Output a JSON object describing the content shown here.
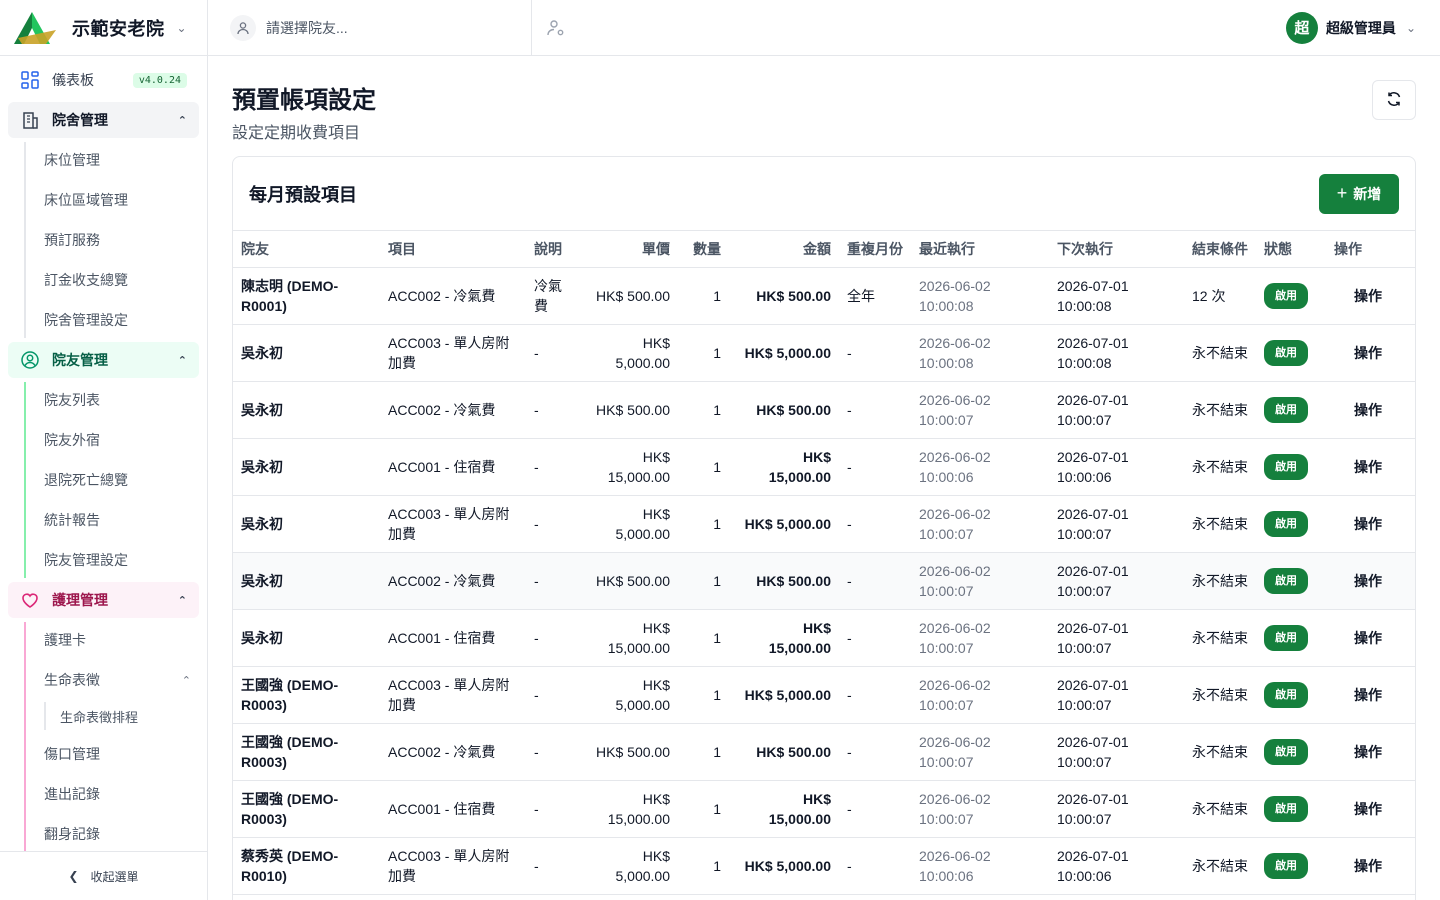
{
  "header": {
    "brand_name": "示範安老院",
    "resident_placeholder": "請選擇院友...",
    "user_initial": "超",
    "user_name": "超級管理員",
    "brand_colors": {
      "green": "#15803d",
      "gold": "#c9a227"
    }
  },
  "sidebar": {
    "dashboard": {
      "label": "儀表板",
      "version": "v4.0.24"
    },
    "groups": [
      {
        "label": "院舍管理",
        "items": [
          "床位管理",
          "床位區域管理",
          "預訂服務",
          "訂金收支總覽",
          "院舍管理設定"
        ]
      },
      {
        "label": "院友管理",
        "items": [
          "院友列表",
          "院友外宿",
          "退院死亡總覽",
          "統計報告",
          "院友管理設定"
        ]
      },
      {
        "label": "護理管理",
        "items": [
          "護理卡",
          "生命表徵",
          "傷口管理",
          "進出記錄",
          "翻身記錄"
        ],
        "nested": {
          "parent": "生命表徵",
          "children": [
            "生命表徵排程"
          ]
        }
      }
    ],
    "collapse_label": "收起選單"
  },
  "page": {
    "title": "預置帳項設定",
    "subtitle": "設定定期收費項目"
  },
  "card": {
    "title": "每月預設項目",
    "add_label": "新增"
  },
  "table": {
    "columns": [
      "院友",
      "項目",
      "說明",
      "單價",
      "數量",
      "金額",
      "重複月份",
      "最近執行",
      "下次執行",
      "結束條件",
      "狀態",
      "操作"
    ],
    "rows": [
      {
        "resident": "陳志明 (DEMO-R0001)",
        "item": "ACC002 - 冷氣費",
        "desc": "冷氣費",
        "price": "HK$ 500.00",
        "qty": "1",
        "amount": "HK$ 500.00",
        "repeat": "全年",
        "last": "2026-06-02 10:00:08",
        "next": "2026-07-01 10:00:08",
        "end": "12 次",
        "status": "啟用",
        "action": "操作"
      },
      {
        "resident": "吳永初",
        "item": "ACC003 - 單人房附加費",
        "desc": "-",
        "price": "HK$ 5,000.00",
        "qty": "1",
        "amount": "HK$ 5,000.00",
        "repeat": "-",
        "last": "2026-06-02 10:00:08",
        "next": "2026-07-01 10:00:08",
        "end": "永不結束",
        "status": "啟用",
        "action": "操作"
      },
      {
        "resident": "吳永初",
        "item": "ACC002 - 冷氣費",
        "desc": "-",
        "price": "HK$ 500.00",
        "qty": "1",
        "amount": "HK$ 500.00",
        "repeat": "-",
        "last": "2026-06-02 10:00:07",
        "next": "2026-07-01 10:00:07",
        "end": "永不結束",
        "status": "啟用",
        "action": "操作"
      },
      {
        "resident": "吳永初",
        "item": "ACC001 - 住宿費",
        "desc": "-",
        "price": "HK$ 15,000.00",
        "qty": "1",
        "amount": "HK$ 15,000.00",
        "repeat": "-",
        "last": "2026-06-02 10:00:06",
        "next": "2026-07-01 10:00:06",
        "end": "永不結束",
        "status": "啟用",
        "action": "操作"
      },
      {
        "resident": "吳永初",
        "item": "ACC003 - 單人房附加費",
        "desc": "-",
        "price": "HK$ 5,000.00",
        "qty": "1",
        "amount": "HK$ 5,000.00",
        "repeat": "-",
        "last": "2026-06-02 10:00:07",
        "next": "2026-07-01 10:00:07",
        "end": "永不結束",
        "status": "啟用",
        "action": "操作"
      },
      {
        "resident": "吳永初",
        "item": "ACC002 - 冷氣費",
        "desc": "-",
        "price": "HK$ 500.00",
        "qty": "1",
        "amount": "HK$ 500.00",
        "repeat": "-",
        "last": "2026-06-02 10:00:07",
        "next": "2026-07-01 10:00:07",
        "end": "永不結束",
        "status": "啟用",
        "action": "操作",
        "highlight": true
      },
      {
        "resident": "吳永初",
        "item": "ACC001 - 住宿費",
        "desc": "-",
        "price": "HK$ 15,000.00",
        "qty": "1",
        "amount": "HK$ 15,000.00",
        "repeat": "-",
        "last": "2026-06-02 10:00:07",
        "next": "2026-07-01 10:00:07",
        "end": "永不結束",
        "status": "啟用",
        "action": "操作"
      },
      {
        "resident": "王國強 (DEMO-R0003)",
        "item": "ACC003 - 單人房附加費",
        "desc": "-",
        "price": "HK$ 5,000.00",
        "qty": "1",
        "amount": "HK$ 5,000.00",
        "repeat": "-",
        "last": "2026-06-02 10:00:07",
        "next": "2026-07-01 10:00:07",
        "end": "永不結束",
        "status": "啟用",
        "action": "操作"
      },
      {
        "resident": "王國強 (DEMO-R0003)",
        "item": "ACC002 - 冷氣費",
        "desc": "-",
        "price": "HK$ 500.00",
        "qty": "1",
        "amount": "HK$ 500.00",
        "repeat": "-",
        "last": "2026-06-02 10:00:07",
        "next": "2026-07-01 10:00:07",
        "end": "永不結束",
        "status": "啟用",
        "action": "操作"
      },
      {
        "resident": "王國強 (DEMO-R0003)",
        "item": "ACC001 - 住宿費",
        "desc": "-",
        "price": "HK$ 15,000.00",
        "qty": "1",
        "amount": "HK$ 15,000.00",
        "repeat": "-",
        "last": "2026-06-02 10:00:07",
        "next": "2026-07-01 10:00:07",
        "end": "永不結束",
        "status": "啟用",
        "action": "操作"
      },
      {
        "resident": "蔡秀英 (DEMO-R0010)",
        "item": "ACC003 - 單人房附加費",
        "desc": "-",
        "price": "HK$ 5,000.00",
        "qty": "1",
        "amount": "HK$ 5,000.00",
        "repeat": "-",
        "last": "2026-06-02 10:00:06",
        "next": "2026-07-01 10:00:06",
        "end": "永不結束",
        "status": "啟用",
        "action": "操作"
      }
    ]
  }
}
